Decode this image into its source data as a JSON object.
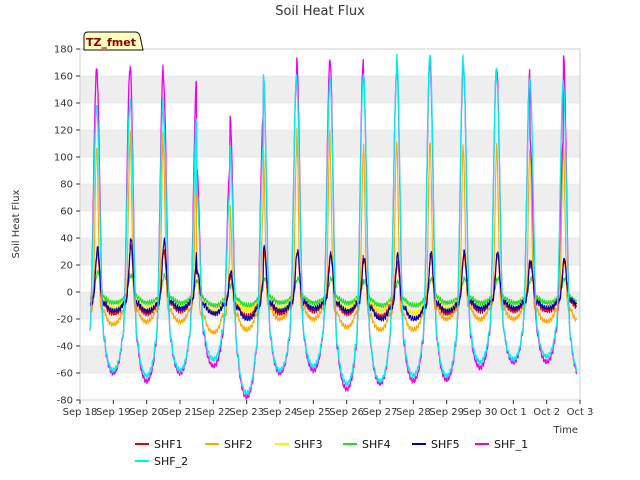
{
  "chart_data": {
    "type": "line",
    "title": "Soil Heat Flux",
    "xlabel": "Time",
    "ylabel": "Soil Heat Flux",
    "tag": "TZ_fmet",
    "ylim": [
      -80,
      180
    ],
    "yticks": [
      -80,
      -60,
      -40,
      -20,
      0,
      20,
      40,
      60,
      80,
      100,
      120,
      140,
      160,
      180
    ],
    "xlim": [
      0,
      15
    ],
    "xtick_labels": [
      "Sep 18",
      "Sep 19",
      "Sep 20",
      "Sep 21",
      "Sep 22",
      "Sep 23",
      "Sep 24",
      "Sep 25",
      "Sep 26",
      "Sep 27",
      "Sep 28",
      "Sep 29",
      "Sep 30",
      "Oct 1",
      "Oct 2",
      "Oct 3"
    ],
    "data_span_days": [
      0.3,
      14.9
    ],
    "grid": "horizontal bands",
    "legend_position": "bottom",
    "colors": {
      "SHF1": "#e60000",
      "SHF2": "#ffa500",
      "SHF3": "#ffee00",
      "SHF4": "#22dd22",
      "SHF5": "#0000b0",
      "SHF_1": "#ee00ee",
      "SHF_2": "#00eeee"
    },
    "series": [
      {
        "name": "SHF1",
        "daily_peaks": [
          30,
          35,
          30,
          15,
          12,
          30,
          30,
          28,
          24,
          22,
          28,
          28,
          28,
          22,
          24
        ],
        "daily_troughs": [
          -16,
          -16,
          -14,
          -16,
          -18,
          -16,
          -14,
          -16,
          -18,
          -20,
          -16,
          -14,
          -14,
          -14,
          -12
        ]
      },
      {
        "name": "SHF2",
        "daily_peaks": [
          108,
          122,
          108,
          25,
          66,
          104,
          122,
          102,
          112,
          110,
          112,
          105,
          108,
          105,
          110
        ],
        "daily_troughs": [
          -24,
          -22,
          -22,
          -30,
          -28,
          -20,
          -20,
          -26,
          -28,
          -28,
          -20,
          -20,
          -20,
          -22,
          -22
        ]
      },
      {
        "name": "SHF3",
        "daily_peaks": [
          28,
          30,
          28,
          12,
          10,
          28,
          28,
          26,
          22,
          22,
          26,
          26,
          26,
          22,
          22
        ],
        "daily_troughs": [
          -12,
          -12,
          -12,
          -14,
          -14,
          -12,
          -12,
          -12,
          -14,
          -16,
          -12,
          -12,
          -12,
          -12,
          -12
        ]
      },
      {
        "name": "SHF4",
        "daily_peaks": [
          15,
          12,
          12,
          8,
          5,
          10,
          10,
          10,
          8,
          8,
          10,
          10,
          10,
          10,
          10
        ],
        "daily_troughs": [
          -8,
          -8,
          -8,
          -10,
          -10,
          -8,
          -8,
          -8,
          -10,
          -10,
          -8,
          -8,
          -8,
          -8,
          -8
        ]
      },
      {
        "name": "SHF5",
        "daily_peaks": [
          33,
          40,
          38,
          15,
          15,
          34,
          30,
          28,
          25,
          28,
          30,
          30,
          30,
          22,
          25
        ],
        "daily_troughs": [
          -14,
          -14,
          -12,
          -16,
          -20,
          -14,
          -12,
          -14,
          -20,
          -20,
          -14,
          -12,
          -12,
          -12,
          -10
        ]
      },
      {
        "name": "SHF_1",
        "daily_peaks": [
          165,
          169,
          158,
          92,
          130,
          160,
          172,
          172,
          162,
          172,
          168,
          168,
          165,
          112,
          177
        ],
        "daily_troughs": [
          -60,
          -66,
          -60,
          -55,
          -78,
          -60,
          -58,
          -72,
          -68,
          -66,
          -65,
          -56,
          -52,
          -52,
          -62
        ]
      },
      {
        "name": "SHF_2",
        "daily_peaks": [
          138,
          145,
          130,
          75,
          108,
          162,
          155,
          160,
          162,
          177,
          175,
          168,
          158,
          157,
          152
        ],
        "daily_troughs": [
          -58,
          -62,
          -58,
          -50,
          -75,
          -58,
          -55,
          -68,
          -66,
          -62,
          -62,
          -52,
          -50,
          -48,
          -60
        ]
      }
    ]
  }
}
